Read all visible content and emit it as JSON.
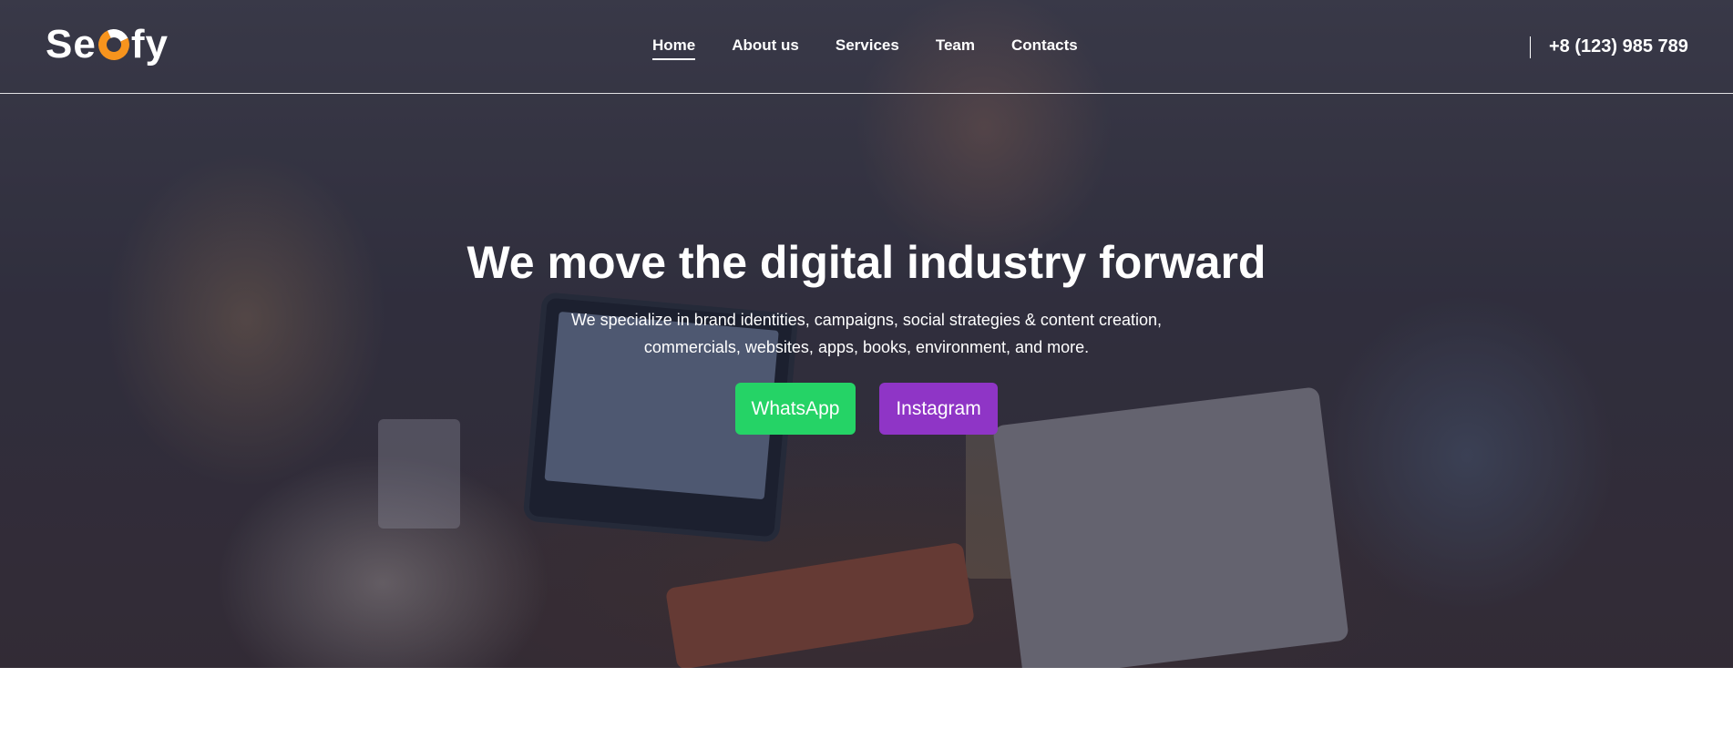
{
  "brand": {
    "logo_left": "Se",
    "logo_right": "fy"
  },
  "nav": {
    "items": [
      {
        "label": "Home",
        "active": true
      },
      {
        "label": "About us",
        "active": false
      },
      {
        "label": "Services",
        "active": false
      },
      {
        "label": "Team",
        "active": false
      },
      {
        "label": "Contacts",
        "active": false
      }
    ]
  },
  "header": {
    "phone": "+8 (123) 985 789"
  },
  "hero": {
    "title": "We move the digital industry forward",
    "text_line1": "We specialize in brand identities, campaigns, social strategies & content creation,",
    "text_line2": "commercials, websites, apps, books, environment, and more.",
    "buttons": {
      "whatsapp": "WhatsApp",
      "instagram": "Instagram"
    }
  },
  "colors": {
    "whatsapp": "#25d366",
    "instagram": "#8f35c6",
    "logo_accent": "#f7941d"
  }
}
